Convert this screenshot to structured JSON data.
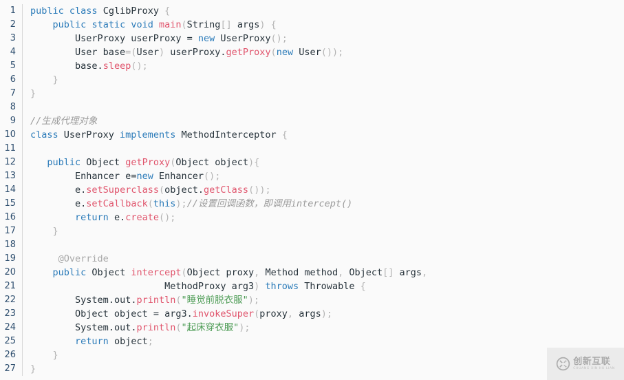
{
  "editor": {
    "language": "java",
    "background_color": "#fafafa",
    "gutter_separator_color": "#d8d8d8",
    "line_number_color": "#2f4f6f",
    "token_colors": {
      "keyword": "#2b7bb9",
      "function": "#e0536b",
      "string": "#4a9a52",
      "comment": "#9b9b9b",
      "annotation": "#a8a8a8",
      "punctuation": "#b4b4b4",
      "plain": "#26323a"
    },
    "first_line_number": 1,
    "last_line_number": 27,
    "lines": [
      {
        "n": "1",
        "tokens": [
          {
            "t": "public",
            "c": "kw"
          },
          {
            "t": " ",
            "c": "pln"
          },
          {
            "t": "class",
            "c": "kw"
          },
          {
            "t": " CglibProxy ",
            "c": "pln"
          },
          {
            "t": "{",
            "c": "pun"
          }
        ]
      },
      {
        "n": "2",
        "tokens": [
          {
            "t": "    ",
            "c": "pln"
          },
          {
            "t": "public",
            "c": "kw"
          },
          {
            "t": " ",
            "c": "pln"
          },
          {
            "t": "static",
            "c": "kw"
          },
          {
            "t": " ",
            "c": "pln"
          },
          {
            "t": "void",
            "c": "kw"
          },
          {
            "t": " ",
            "c": "pln"
          },
          {
            "t": "main",
            "c": "fn"
          },
          {
            "t": "(",
            "c": "pun"
          },
          {
            "t": "String",
            "c": "pln"
          },
          {
            "t": "[]",
            "c": "pun"
          },
          {
            "t": " args",
            "c": "pln"
          },
          {
            "t": ")",
            "c": "pun"
          },
          {
            "t": " ",
            "c": "pln"
          },
          {
            "t": "{",
            "c": "pun"
          }
        ]
      },
      {
        "n": "3",
        "tokens": [
          {
            "t": "        UserProxy userProxy ",
            "c": "pln"
          },
          {
            "t": "=",
            "c": "pln"
          },
          {
            "t": " ",
            "c": "pln"
          },
          {
            "t": "new",
            "c": "kw"
          },
          {
            "t": " UserProxy",
            "c": "pln"
          },
          {
            "t": "();",
            "c": "pun"
          }
        ]
      },
      {
        "n": "4",
        "tokens": [
          {
            "t": "        User base",
            "c": "pln"
          },
          {
            "t": "=(",
            "c": "pun"
          },
          {
            "t": "User",
            "c": "pln"
          },
          {
            "t": ")",
            "c": "pun"
          },
          {
            "t": " userProxy",
            "c": "pln"
          },
          {
            "t": ".",
            "c": "pln"
          },
          {
            "t": "getProxy",
            "c": "fn"
          },
          {
            "t": "(",
            "c": "pun"
          },
          {
            "t": "new",
            "c": "kw"
          },
          {
            "t": " User",
            "c": "pln"
          },
          {
            "t": "());",
            "c": "pun"
          }
        ]
      },
      {
        "n": "5",
        "tokens": [
          {
            "t": "        base",
            "c": "pln"
          },
          {
            "t": ".",
            "c": "pln"
          },
          {
            "t": "sleep",
            "c": "fn"
          },
          {
            "t": "();",
            "c": "pun"
          }
        ]
      },
      {
        "n": "6",
        "tokens": [
          {
            "t": "    ",
            "c": "pln"
          },
          {
            "t": "}",
            "c": "pun"
          }
        ]
      },
      {
        "n": "7",
        "tokens": [
          {
            "t": "}",
            "c": "pun"
          }
        ]
      },
      {
        "n": "8",
        "tokens": []
      },
      {
        "n": "9",
        "tokens": [
          {
            "t": "//生成代理对象",
            "c": "cmt"
          }
        ]
      },
      {
        "n": "10",
        "tokens": [
          {
            "t": "class",
            "c": "kw"
          },
          {
            "t": " UserProxy ",
            "c": "pln"
          },
          {
            "t": "implements",
            "c": "kw"
          },
          {
            "t": " MethodInterceptor ",
            "c": "pln"
          },
          {
            "t": "{",
            "c": "pun"
          }
        ]
      },
      {
        "n": "11",
        "tokens": []
      },
      {
        "n": "12",
        "tokens": [
          {
            "t": "   ",
            "c": "pln"
          },
          {
            "t": "public",
            "c": "kw"
          },
          {
            "t": " Object ",
            "c": "pln"
          },
          {
            "t": "getProxy",
            "c": "fn"
          },
          {
            "t": "(",
            "c": "pun"
          },
          {
            "t": "Object object",
            "c": "pln"
          },
          {
            "t": "){",
            "c": "pun"
          }
        ]
      },
      {
        "n": "13",
        "tokens": [
          {
            "t": "        Enhancer e",
            "c": "pln"
          },
          {
            "t": "=",
            "c": "pln"
          },
          {
            "t": "new",
            "c": "kw"
          },
          {
            "t": " Enhancer",
            "c": "pln"
          },
          {
            "t": "();",
            "c": "pun"
          }
        ]
      },
      {
        "n": "14",
        "tokens": [
          {
            "t": "        e",
            "c": "pln"
          },
          {
            "t": ".",
            "c": "pln"
          },
          {
            "t": "setSuperclass",
            "c": "fn"
          },
          {
            "t": "(",
            "c": "pun"
          },
          {
            "t": "object",
            "c": "pln"
          },
          {
            "t": ".",
            "c": "pln"
          },
          {
            "t": "getClass",
            "c": "fn"
          },
          {
            "t": "());",
            "c": "pun"
          }
        ]
      },
      {
        "n": "15",
        "tokens": [
          {
            "t": "        e",
            "c": "pln"
          },
          {
            "t": ".",
            "c": "pln"
          },
          {
            "t": "setCallback",
            "c": "fn"
          },
          {
            "t": "(",
            "c": "pun"
          },
          {
            "t": "this",
            "c": "kw"
          },
          {
            "t": ");",
            "c": "pun"
          },
          {
            "t": "//设置回调函数，即调用intercept()",
            "c": "cmt"
          }
        ]
      },
      {
        "n": "16",
        "tokens": [
          {
            "t": "        ",
            "c": "pln"
          },
          {
            "t": "return",
            "c": "kw"
          },
          {
            "t": " e",
            "c": "pln"
          },
          {
            "t": ".",
            "c": "pln"
          },
          {
            "t": "create",
            "c": "fn"
          },
          {
            "t": "();",
            "c": "pun"
          }
        ]
      },
      {
        "n": "17",
        "tokens": [
          {
            "t": "    ",
            "c": "pln"
          },
          {
            "t": "}",
            "c": "pun"
          }
        ]
      },
      {
        "n": "18",
        "tokens": []
      },
      {
        "n": "19",
        "tokens": [
          {
            "t": "     ",
            "c": "pln"
          },
          {
            "t": "@Override",
            "c": "ann"
          }
        ]
      },
      {
        "n": "20",
        "tokens": [
          {
            "t": "    ",
            "c": "pln"
          },
          {
            "t": "public",
            "c": "kw"
          },
          {
            "t": " Object ",
            "c": "pln"
          },
          {
            "t": "intercept",
            "c": "fn"
          },
          {
            "t": "(",
            "c": "pun"
          },
          {
            "t": "Object proxy",
            "c": "pln"
          },
          {
            "t": ",",
            "c": "pun"
          },
          {
            "t": " Method method",
            "c": "pln"
          },
          {
            "t": ",",
            "c": "pun"
          },
          {
            "t": " Object",
            "c": "pln"
          },
          {
            "t": "[]",
            "c": "pun"
          },
          {
            "t": " args",
            "c": "pln"
          },
          {
            "t": ",",
            "c": "pun"
          }
        ]
      },
      {
        "n": "21",
        "tokens": [
          {
            "t": "                        MethodProxy arg3",
            "c": "pln"
          },
          {
            "t": ")",
            "c": "pun"
          },
          {
            "t": " ",
            "c": "pln"
          },
          {
            "t": "throws",
            "c": "kw"
          },
          {
            "t": " Throwable ",
            "c": "pln"
          },
          {
            "t": "{",
            "c": "pun"
          }
        ]
      },
      {
        "n": "22",
        "tokens": [
          {
            "t": "        System",
            "c": "pln"
          },
          {
            "t": ".",
            "c": "pln"
          },
          {
            "t": "out",
            "c": "pln"
          },
          {
            "t": ".",
            "c": "pln"
          },
          {
            "t": "println",
            "c": "fn"
          },
          {
            "t": "(",
            "c": "pun"
          },
          {
            "t": "\"睡觉前脱衣服\"",
            "c": "str"
          },
          {
            "t": ");",
            "c": "pun"
          }
        ]
      },
      {
        "n": "23",
        "tokens": [
          {
            "t": "        Object object ",
            "c": "pln"
          },
          {
            "t": "=",
            "c": "pln"
          },
          {
            "t": " arg3",
            "c": "pln"
          },
          {
            "t": ".",
            "c": "pln"
          },
          {
            "t": "invokeSuper",
            "c": "fn"
          },
          {
            "t": "(",
            "c": "pun"
          },
          {
            "t": "proxy",
            "c": "pln"
          },
          {
            "t": ",",
            "c": "pun"
          },
          {
            "t": " args",
            "c": "pln"
          },
          {
            "t": ");",
            "c": "pun"
          }
        ]
      },
      {
        "n": "24",
        "tokens": [
          {
            "t": "        System",
            "c": "pln"
          },
          {
            "t": ".",
            "c": "pln"
          },
          {
            "t": "out",
            "c": "pln"
          },
          {
            "t": ".",
            "c": "pln"
          },
          {
            "t": "println",
            "c": "fn"
          },
          {
            "t": "(",
            "c": "pun"
          },
          {
            "t": "\"起床穿衣服\"",
            "c": "str"
          },
          {
            "t": ");",
            "c": "pun"
          }
        ]
      },
      {
        "n": "25",
        "tokens": [
          {
            "t": "        ",
            "c": "pln"
          },
          {
            "t": "return",
            "c": "kw"
          },
          {
            "t": " object",
            "c": "pln"
          },
          {
            "t": ";",
            "c": "pun"
          }
        ]
      },
      {
        "n": "26",
        "tokens": [
          {
            "t": "    ",
            "c": "pln"
          },
          {
            "t": "}",
            "c": "pun"
          }
        ]
      },
      {
        "n": "27",
        "tokens": [
          {
            "t": "}",
            "c": "pun"
          }
        ]
      }
    ]
  },
  "watermark": {
    "logo_name": "circle-x-logo-icon",
    "cn_text": "创新互联",
    "en_text": "CHUANG XIN HU LIAN",
    "background_color": "#ebebeb",
    "text_color": "#a6a6a6"
  }
}
